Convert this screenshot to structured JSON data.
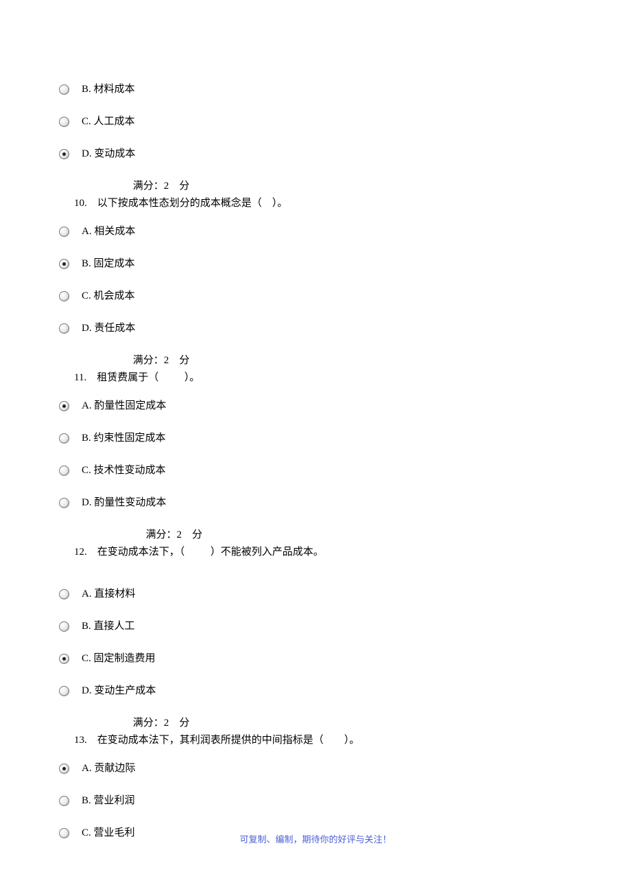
{
  "q9_tail": {
    "options": [
      {
        "label": "B. 材料成本",
        "selected": false
      },
      {
        "label": "C. 人工成本",
        "selected": false
      },
      {
        "label": "D. 变动成本",
        "selected": true
      }
    ],
    "score": " 满分：2    分"
  },
  "q10": {
    "stem": "10.    以下按成本性态划分的成本概念是（    ）。",
    "options": [
      {
        "label": "A. 相关成本",
        "selected": false
      },
      {
        "label": "B. 固定成本",
        "selected": true
      },
      {
        "label": "C. 机会成本",
        "selected": false
      },
      {
        "label": "D. 责任成本",
        "selected": false
      }
    ],
    "score": " 满分：2    分"
  },
  "q11": {
    "stem": "11.    租赁费属于（          ）。",
    "options": [
      {
        "label": "A. 酌量性固定成本",
        "selected": true
      },
      {
        "label": "B. 约束性固定成本",
        "selected": false
      },
      {
        "label": "C. 技术性变动成本",
        "selected": false
      },
      {
        "label": "D. 酌量性变动成本",
        "selected": false
      }
    ],
    "score": "      满分：2    分"
  },
  "q12": {
    "stem": "12.    在变动成本法下，（          ）不能被列入产品成本。",
    "options": [
      {
        "label": "A. 直接材料",
        "selected": false
      },
      {
        "label": "B. 直接人工",
        "selected": false
      },
      {
        "label": "C. 固定制造费用",
        "selected": true
      },
      {
        "label": "D. 变动生产成本",
        "selected": false
      }
    ],
    "score": " 满分：2    分"
  },
  "q13": {
    "stem": "13.    在变动成本法下，其利润表所提供的中间指标是（        ）。",
    "options": [
      {
        "label": "A. 贡献边际",
        "selected": true
      },
      {
        "label": "B. 营业利润",
        "selected": false
      },
      {
        "label": "C. 营业毛利",
        "selected": false
      }
    ]
  },
  "footer": "可复制、编制，期待你的好评与关注！"
}
